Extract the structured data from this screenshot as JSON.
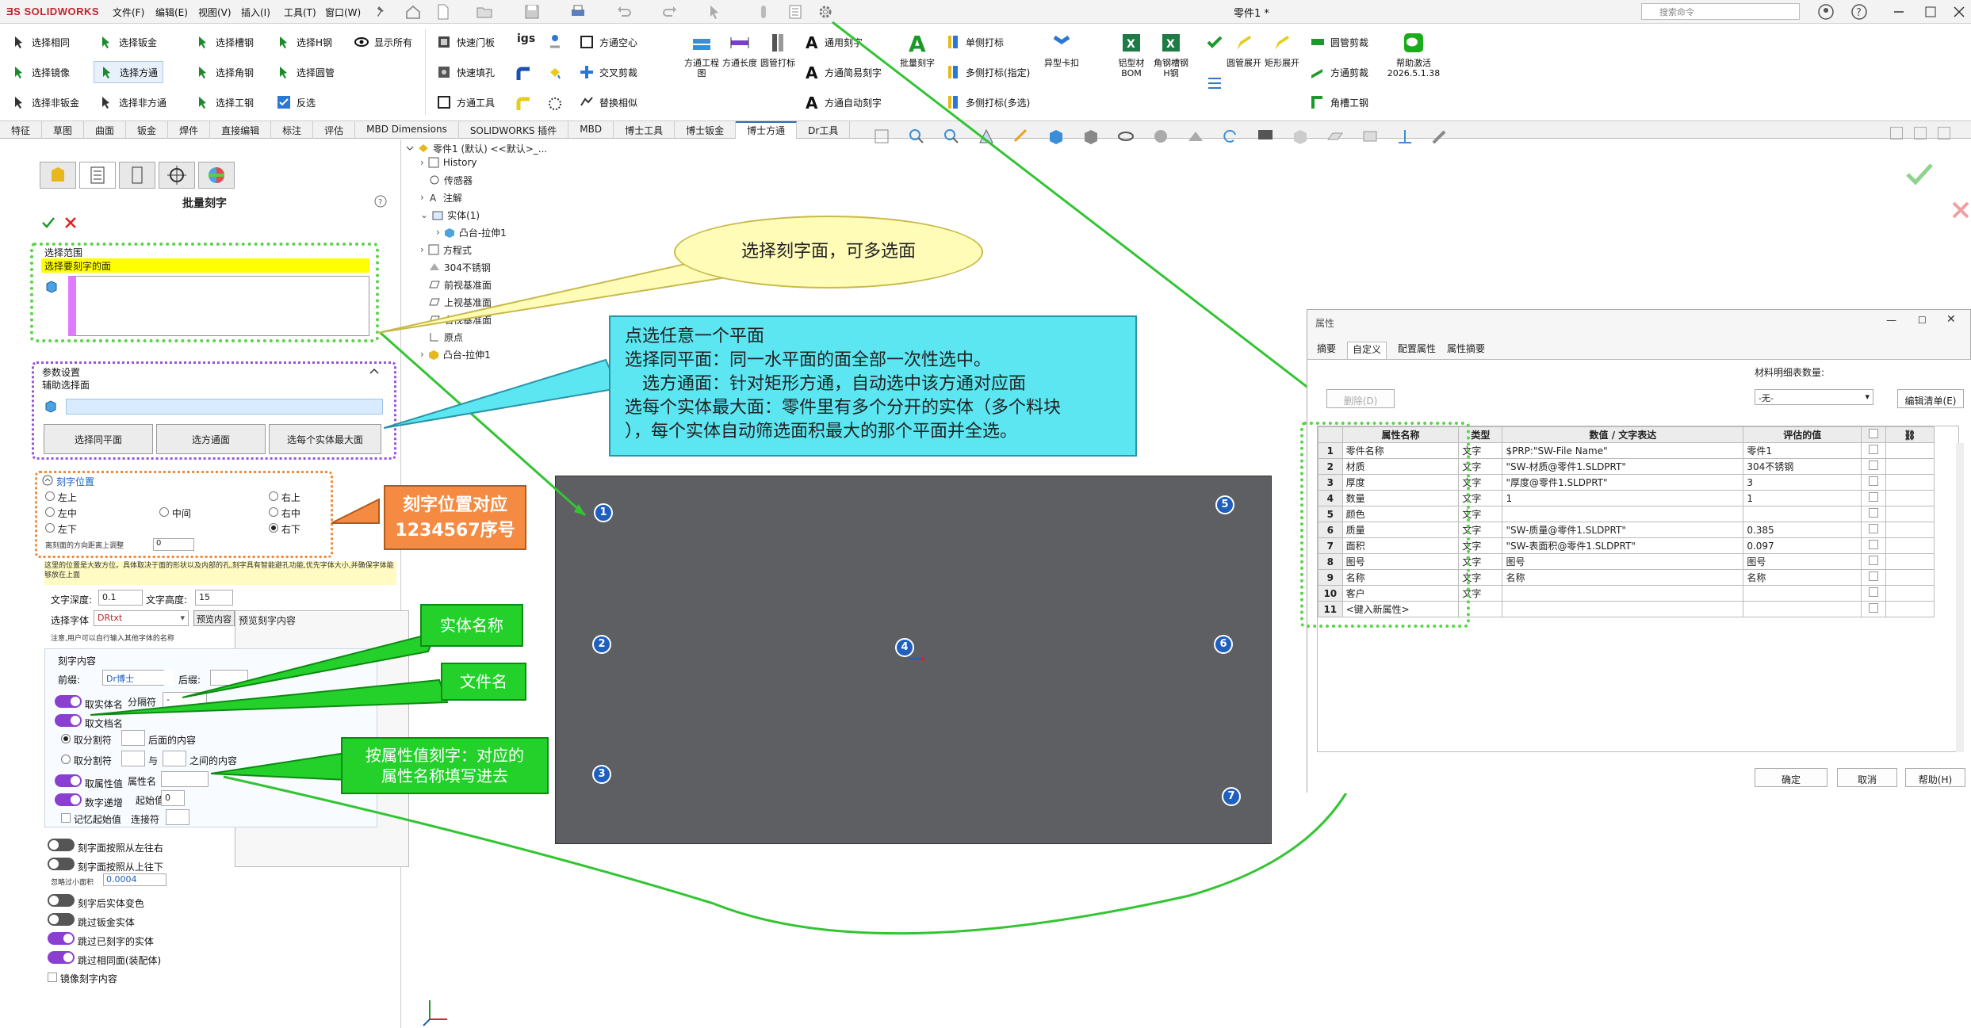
{
  "topbar": {
    "brand": "SOLIDWORKS",
    "menus": [
      "文件(F)",
      "编辑(E)",
      "视图(V)",
      "插入(I)",
      "工具(T)",
      "窗口(W)"
    ],
    "doc_title": "零件1 *",
    "search_placeholder": "搜索命令"
  },
  "cmd": {
    "col1": [
      "选择相同",
      "选择镜像",
      "选择非钣金"
    ],
    "col2": [
      "选择钣金",
      "选择方通",
      "选择非方通"
    ],
    "col3": [
      "选择槽钢",
      "选择角钢",
      "选择工钢"
    ],
    "col4": [
      "选择H钢",
      "选择圆管",
      "反选"
    ],
    "col5": [
      "显示所有"
    ],
    "col6": [
      "快速门板",
      "快速填孔",
      "方通工具"
    ],
    "col7": [
      "igs",
      "",
      ""
    ],
    "col8": [
      "方通空心",
      "交叉剪裁",
      "替换相似"
    ],
    "big1": "方通工程图",
    "big2": "方通长度",
    "big3": "圆管打标",
    "col9": [
      "通用刻字",
      "方通简易刻字",
      "方通自动刻字"
    ],
    "big4": "批量刻字",
    "col10": [
      "单侧打标",
      "多侧打标(指定)",
      "多侧打标(多选)"
    ],
    "big5": "异型卡扣",
    "big6": "铝型材BOM",
    "big7": "角钢槽钢H钢",
    "big8": "圆管展开",
    "big9": "矩形展开",
    "col11": [
      "圆管剪裁",
      "方通剪裁",
      "角槽工钢"
    ],
    "big10": "帮助激活",
    "version": "2026.5.1.38"
  },
  "tabs": [
    "特征",
    "草图",
    "曲面",
    "钣金",
    "焊件",
    "直接编辑",
    "标注",
    "评估",
    "MBD Dimensions",
    "SOLIDWORKS 插件",
    "MBD",
    "博士工具",
    "博士钣金",
    "博士方通",
    "Dr工具"
  ],
  "active_tab": "博士方通",
  "pm": {
    "title": "批量刻字",
    "sel_range": "选择范围",
    "sel_prompt": "选择要刻字的面",
    "param_title": "参数设置",
    "aux_label": "辅助选择面",
    "btn_same": "选择同平面",
    "btn_tube": "选方通面",
    "btn_max": "选每个实体最大面",
    "pos_title": "刻字位置",
    "pos": [
      "左上",
      "右上",
      "左中",
      "中间",
      "右中",
      "左下",
      "右下"
    ],
    "pos_selected": "右下",
    "offset_label": "离刻面的方向距离上调整",
    "offset_val": "0",
    "note1": "这里的位置是大致方位。具体取决于面的形状以及内部的孔,刻字具有智能避孔功能,优先字体大小,并确保字体能够放在上面",
    "depth_label": "文字深度:",
    "depth_val": "0.1",
    "height_label": "文字高度:",
    "height_val": "15",
    "font_label": "选择字体",
    "font_val": "DRtxt",
    "preview_label": "预览内容",
    "preview_text": "预览刻字内容",
    "note2": "注意,用户可以自行输入其他字体的名称",
    "content_title": "刻字内容",
    "prefix_label": "前缀:",
    "prefix_val": "Dr博士",
    "suffix_label": "后缀:",
    "opt_body": "取实体名",
    "sep_label": "分隔符",
    "sep_val": "-",
    "opt_file": "取文档名",
    "opt_split1": "取分割符",
    "after_label": "后面的内容",
    "opt_split2": "取分割符",
    "and_label": "与",
    "between_label": "之间的内容",
    "opt_prop": "取属性值",
    "prop_label": "属性名",
    "opt_inc": "数字递增",
    "start_label": "起始值",
    "start_val": "0",
    "remember": "记忆起始值",
    "joiner": "连接符",
    "t1": "刻字面按照从左往右",
    "t2": "刻字面按照从上往下",
    "area_label": "忽略过小面积",
    "area_val": "0.0004",
    "t3": "刻字后实体变色",
    "t4": "跳过钣金实体",
    "t5": "跳过已刻字的实体",
    "t6": "跳过相同面(装配体)",
    "mirror": "镜像刻字内容"
  },
  "tree": {
    "root": "零件1 (默认) <<默认>_...",
    "items": [
      "History",
      "传感器",
      "注解",
      "实体(1)",
      "凸台-拉伸1",
      "方程式",
      "304不锈钢",
      "前视基准面",
      "上视基准面",
      "右视基准面",
      "原点",
      "凸台-拉伸1"
    ]
  },
  "callouts": {
    "c1": "选择刻字面，可多选面",
    "c2": [
      "点选任意一个平面",
      "选择同平面：同一水平面的面全部一次性选中。",
      "　选方通面：针对矩形方通，自动选中该方通对应面",
      "选每个实体最大面：零件里有多个分开的实体（多个料块",
      "），每个实体自动筛选面积最大的那个平面并全选。"
    ],
    "c3": [
      "刻字位置对应",
      "1234567序号"
    ],
    "c4": "实体名称",
    "c5": "文件名",
    "c6": [
      "按属性值刻字：对应的",
      "属性名称填写进去"
    ]
  },
  "dots": [
    "1",
    "2",
    "3",
    "4",
    "5",
    "6",
    "7"
  ],
  "dialog": {
    "title": "属性",
    "tabs": [
      "摘要",
      "自定义",
      "配置属性",
      "属性摘要"
    ],
    "delete_btn": "删除(D)",
    "bom_label": "材料明细表数量:",
    "bom_val": "-无-",
    "edit_btn": "编辑清单(E)",
    "headers": [
      "属性名称",
      "类型",
      "数值 / 文字表达",
      "评估的值"
    ],
    "rows": [
      [
        "1",
        "零件名称",
        "文字",
        "$PRP:\"SW-File Name\"",
        "零件1"
      ],
      [
        "2",
        "材质",
        "文字",
        "\"SW-材质@零件1.SLDPRT\"",
        "304不锈钢"
      ],
      [
        "3",
        "厚度",
        "文字",
        "\"厚度@零件1.SLDPRT\"",
        "3"
      ],
      [
        "4",
        "数量",
        "文字",
        "1",
        "1"
      ],
      [
        "5",
        "颜色",
        "文字",
        "",
        ""
      ],
      [
        "6",
        "质量",
        "文字",
        "\"SW-质量@零件1.SLDPRT\"",
        "0.385"
      ],
      [
        "7",
        "面积",
        "文字",
        "\"SW-表面积@零件1.SLDPRT\"",
        "0.097"
      ],
      [
        "8",
        "图号",
        "文字",
        "图号",
        "图号"
      ],
      [
        "9",
        "名称",
        "文字",
        "名称",
        "名称"
      ],
      [
        "10",
        "客户",
        "文字",
        "",
        ""
      ],
      [
        "11",
        "<键入新属性>",
        "",
        "",
        ""
      ]
    ],
    "ok": "确定",
    "cancel": "取消",
    "help": "帮助(H)"
  }
}
